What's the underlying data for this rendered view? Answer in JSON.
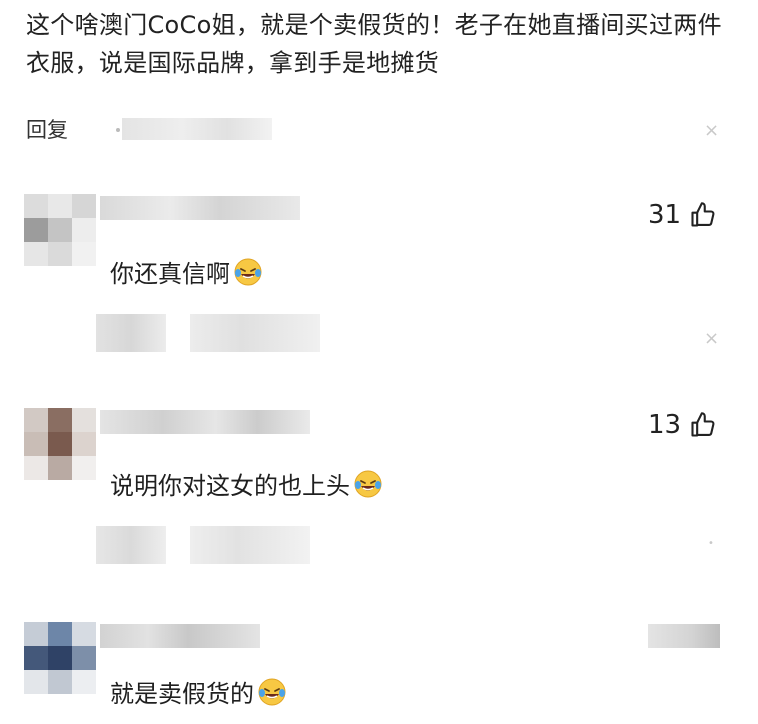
{
  "main_comment": {
    "text": "这个啥澳门CoCo姐，就是个卖假货的！老子在她直播间买过两件衣服，说是国际品牌，拿到手是地摊货"
  },
  "reply_bar": {
    "label": "回复",
    "close_glyph": "×"
  },
  "replies": [
    {
      "likes": "31",
      "text": "你还真信啊",
      "emoji": "laugh-crying-emoji"
    },
    {
      "likes": "13",
      "text": "说明你对这女的也上头",
      "emoji": "laugh-crying-emoji"
    },
    {
      "likes": "",
      "text": "就是卖假货的",
      "emoji": "laugh-crying-emoji"
    }
  ],
  "icons": {
    "like": "thumbs-up-icon",
    "close": "close-icon",
    "emoji": "laugh-crying-emoji"
  },
  "colors": {
    "text": "#1f1f1f",
    "muted": "#c9c9c9",
    "blur": "#e6e6e6"
  }
}
